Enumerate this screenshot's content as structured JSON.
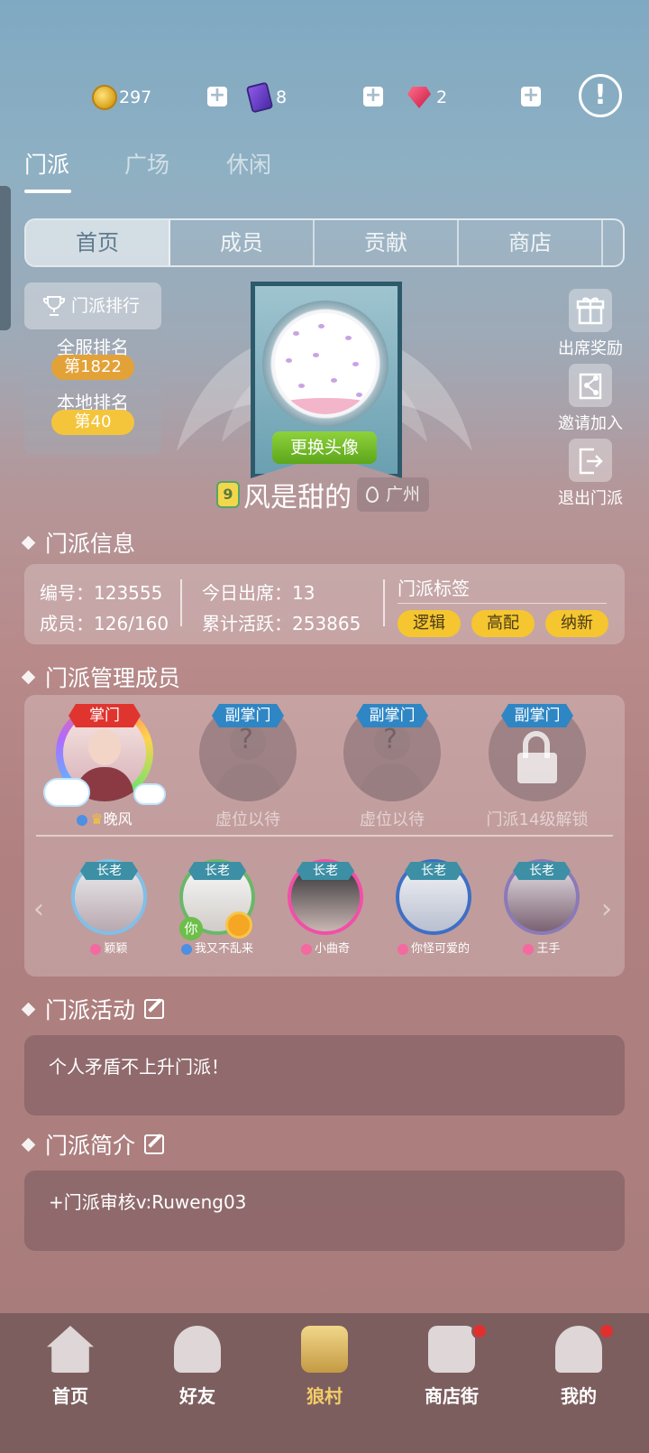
{
  "currency": {
    "coins": "297",
    "cards": "8",
    "gems": "2"
  },
  "top_tabs": [
    "门派",
    "广场",
    "休闲"
  ],
  "sub_tabs": [
    "首页",
    "成员",
    "贡献",
    "商店"
  ],
  "rank": {
    "title": "门派排行",
    "global_label": "全服排名",
    "global_value": "第1822",
    "local_label": "本地排名",
    "local_value": "第40"
  },
  "clan": {
    "change_avatar": "更换头像",
    "level": "9",
    "name": "风是甜的",
    "location": "广州"
  },
  "actions": {
    "attend": "出席奖励",
    "invite": "邀请加入",
    "quit": "退出门派"
  },
  "info": {
    "heading": "门派信息",
    "id": "编号：123555",
    "members": "成员：126/160",
    "today": "今日出席：13",
    "activity": "累计活跃：253865",
    "tags_title": "门派标签",
    "tags": [
      "逻辑",
      "高配",
      "纳新"
    ]
  },
  "managers": {
    "heading": "门派管理成员",
    "leader_badge": "掌门",
    "leader_name": "晚风",
    "vice": [
      {
        "badge": "副掌门",
        "label": "虚位以待"
      },
      {
        "badge": "副掌门",
        "label": "虚位以待"
      },
      {
        "badge": "副掌门",
        "label": "门派14级解锁"
      }
    ],
    "elders": [
      {
        "badge": "长老",
        "name": "颖颖"
      },
      {
        "badge": "长老",
        "name": "我又不乱来"
      },
      {
        "badge": "长老",
        "name": "小曲奇"
      },
      {
        "badge": "长老",
        "name": "你怪可爱的"
      },
      {
        "badge": "长老",
        "name": "王手"
      }
    ],
    "you_tag": "你"
  },
  "activity": {
    "heading": "门派活动",
    "text": "个人矛盾不上升门派！"
  },
  "intro": {
    "heading": "门派简介",
    "text": "+门派审核v:Ruweng03"
  },
  "nav": [
    "首页",
    "好友",
    "狼村",
    "商店街",
    "我的"
  ]
}
